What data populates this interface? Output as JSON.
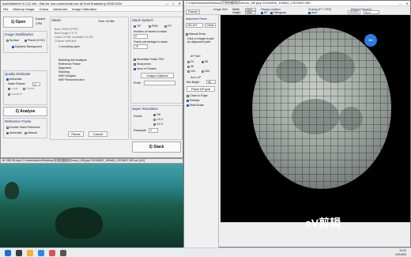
{
  "main_window": {
    "title": "AutoStakkert! 4.0.11 x64 - Bits for non-commercial use @ Emil Kraaikamp 2009-2024",
    "menu": [
      "File",
      "Memory Usage",
      "Colour",
      "Advanced",
      "Image Calibration"
    ],
    "open_btn": "1) Open",
    "expand": "Expand",
    "cpm": "CPM",
    "status_title": "Status",
    "status_line1": "Time: 16.96s",
    "status_lines": [
      "Best: 00000 (FPS)",
      "Best Image 0.0 %",
      "Load 2.0 MB, available 4.6 GB",
      "Chance sufficient",
      "1 recording open"
    ],
    "steps": [
      "Buffering and Analysis",
      "Reference Frame",
      "Alignment",
      "Stacking",
      "MAP Analysis",
      "MAP Reconstruction"
    ],
    "stabilization_title": "Image Stabilization",
    "stab_surface": "Surface",
    "stab_planet": "Planet (COG)",
    "stab_dynamic": "Dynamic Background",
    "quality_title": "Quality Estimator",
    "q_auto": "Automatic",
    "q_noise": "Noise Robust",
    "q_local": "Local",
    "q_global": "Global",
    "q_gradient": "Gradient",
    "analyse_btn": "2) Analyse",
    "ref_title": "Reference Frame",
    "ref_double": "Double Stack Reference",
    "ref_auto": "Automatic",
    "ref_manual": "Manual",
    "pause_btn": "Pause",
    "cancel_btn": "Cancel",
    "stack_opts_title": "Stack Options",
    "tif": "TIF",
    "png": "PNG",
    "fit": "FIT",
    "num_frames_label": "Number of frames to stack",
    "frame_pct_label": "Frame percentage to stack",
    "num_frames_val": "0",
    "pct_val": "70",
    "normalize": "Normalize Stack",
    "normalize_val": "75%",
    "sharpened": "Sharpened",
    "save_folders": "Save in Folders",
    "output_btn": "Output Options",
    "prefix_label": "Prefix",
    "super_res_title": "Super Resolution",
    "drizzle": "Drizzle",
    "off": "Off",
    "x15": "1.5 X",
    "x30": "3.0 X",
    "resample": "Resample",
    "resample_val": "0",
    "stack_btn": "3) Stack",
    "statusbar": "#f: 285     55.hopl    C:\\Users\\Admin\\Desktop\\月亮拍摄测试\\moon_1fff.pjcp 20240803_100640_CSC6507-NR.ser [4/1]"
  },
  "second_window": {
    "title": "C:\\Users\\Admin\\Desktop\\月亮拍摄测试\\moon_1fff.pjcp 20240803_100640_CSC6507-NR...",
    "tab": "Frames",
    "img_size_title": "Image Size",
    "width_label": "Width",
    "height_label": "Height",
    "width_val": "1920",
    "height_val": "1080",
    "disp_title": "Display Options",
    "ap_label": "AP",
    "hist_label": "Histogram",
    "brightness_label": "Brightness",
    "brightness_val": "1.0",
    "scaling_title": "Scaling (F7 / SF9)",
    "auto_label": "Auto",
    "range_label": "Range",
    "range_val": "1.0",
    "report_title": "Report Frame(s)",
    "current_label": "Current",
    "current_val": "50 %",
    "align_title": "Alignment Points",
    "zoom_val": "161.6%",
    "clear_btn": "Clear",
    "manual_label": "Manual Draw",
    "help_text": "Click in Image to add an alignment point",
    "ap_size_title": "AP Size",
    "sizes": [
      "24",
      "56",
      "48",
      "104",
      "200"
    ],
    "auto_ap": "Auto AP",
    "min_bright": "Min Bright",
    "min_bright_val": "40",
    "place_btn": "Place AP grid",
    "close_edge": "Close to Edge",
    "redraw": "Redraw",
    "multi_scale": "Multi-Scale",
    "ap_badge": "361"
  },
  "watermark": "eV剪辑",
  "taskbar": {
    "time": "13:02",
    "date": "2024/8/3"
  }
}
